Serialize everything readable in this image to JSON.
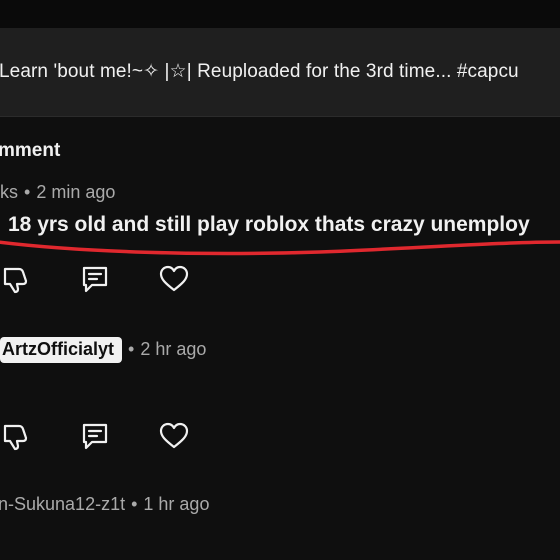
{
  "video": {
    "title": "Learn 'bout me!~✧ |☆| Reuploaded for the 3rd time... #capcu"
  },
  "comments_section": {
    "heading": "mment"
  },
  "comments": [
    {
      "author": "ks",
      "time": "2 min ago",
      "text": "18 yrs old and still play roblox thats crazy unemploy",
      "annotation_color": "#e0282e"
    },
    {
      "author": "ArtzOfficialyt",
      "time": "2 hr ago"
    },
    {
      "author": "n-Sukuna12-z1t",
      "time": "1 hr ago"
    }
  ],
  "icons": {
    "dislike": "thumbs-down-icon",
    "reply": "comment-reply-icon",
    "like": "heart-icon"
  },
  "separator": "•"
}
